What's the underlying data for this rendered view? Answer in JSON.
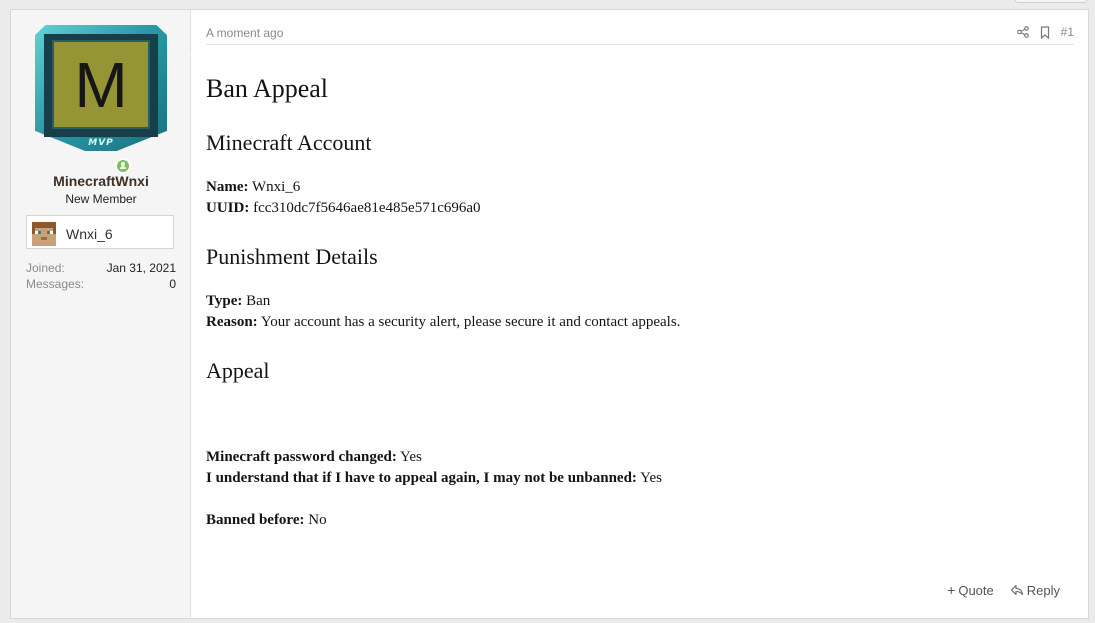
{
  "user": {
    "avatar_letter": "M",
    "badge": "MVP",
    "username": "MinecraftWnxi",
    "title": "New Member",
    "minecraft_name": "Wnxi_6",
    "stats": [
      {
        "label": "Joined:",
        "value": "Jan 31, 2021"
      },
      {
        "label": "Messages:",
        "value": "0"
      }
    ]
  },
  "post": {
    "time": "A moment ago",
    "number": "#1",
    "title": "Ban Appeal",
    "section_account": "Minecraft Account",
    "name_label": "Name:",
    "name_value": "Wnxi_6",
    "uuid_label": "UUID:",
    "uuid_value": "fcc310dc7f5646ae81e485e571c696a0",
    "section_punishment": "Punishment Details",
    "type_label": "Type:",
    "type_value": "Ban",
    "reason_label": "Reason:",
    "reason_value": "Your account has a security alert, please secure it and contact appeals.",
    "section_appeal": "Appeal",
    "pw_label": "Minecraft password changed:",
    "pw_value": "Yes",
    "understand_label": "I understand that if I have to appeal again, I may not be unbanned:",
    "understand_value": "Yes",
    "banned_label": "Banned before:",
    "banned_value": "No"
  },
  "actions": {
    "quote": "Quote",
    "reply": "Reply"
  },
  "colors": {
    "avatar_bg": "#969535",
    "online": "#7ac25a",
    "username": "#3e2f25"
  }
}
